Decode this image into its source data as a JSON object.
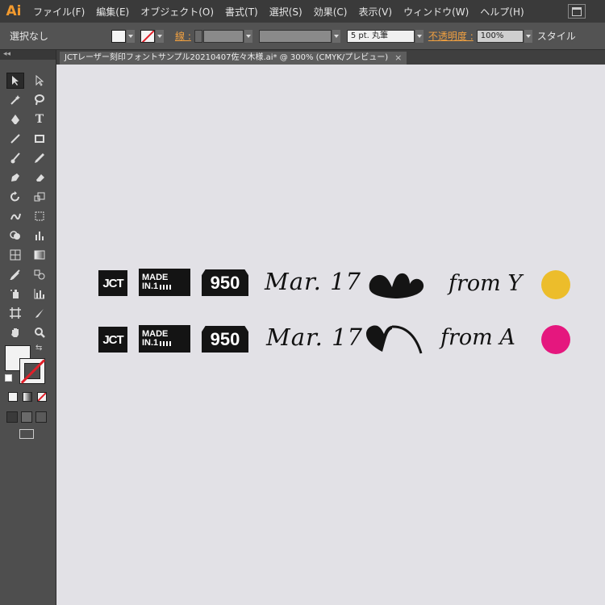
{
  "app": {
    "logo": "Ai"
  },
  "menu": [
    "ファイル(F)",
    "編集(E)",
    "オブジェクト(O)",
    "書式(T)",
    "選択(S)",
    "効果(C)",
    "表示(V)",
    "ウィンドウ(W)",
    "ヘルプ(H)"
  ],
  "control": {
    "selection": "選択なし",
    "stroke_label": "線 :",
    "brush": "5 pt. 丸筆",
    "opacity_label": "不透明度 :",
    "opacity": "100%",
    "style_label": "スタイル"
  },
  "panel": {
    "collapse": "◂◂"
  },
  "tab": {
    "title": "JCTレーザー刻印フォントサンプル20210407佐々木様.ai* @ 300% (CMYK/プレビュー)",
    "close": "×"
  },
  "artwork": {
    "row1": {
      "jct": "JCT",
      "made_top": "MADE",
      "made_bottom": "IN.1",
      "number": "950",
      "date": "Mar. 17",
      "from": "from Y",
      "dot_color": "#ecbd2b"
    },
    "row2": {
      "jct": "JCT",
      "made_top": "MADE",
      "made_bottom": "IN.1",
      "number": "950",
      "date": "Mar. 17",
      "from": "from A",
      "dot_color": "#e5177e"
    }
  }
}
